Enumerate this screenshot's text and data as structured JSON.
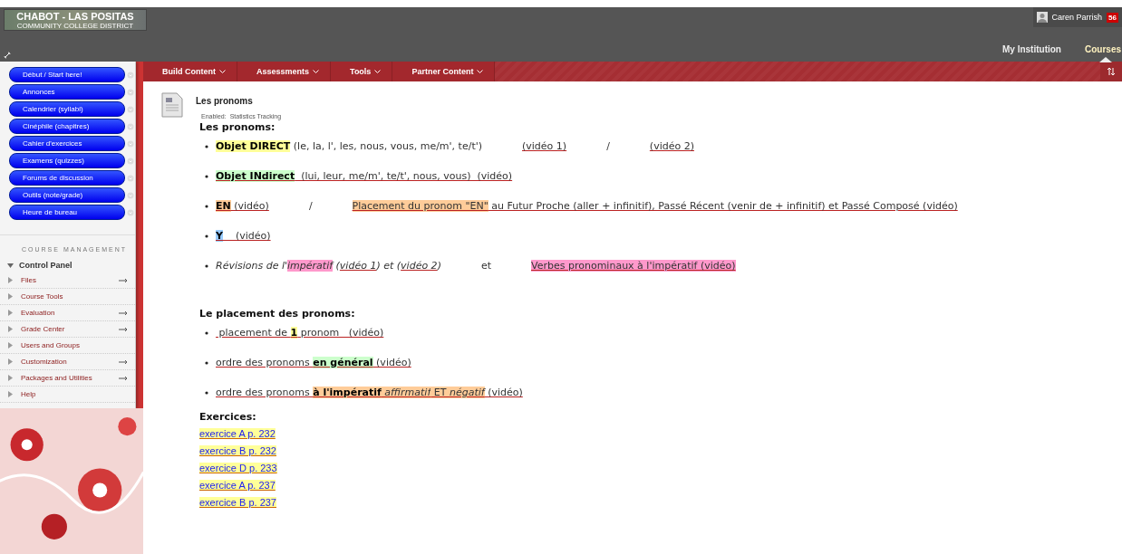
{
  "header": {
    "logo": {
      "line1": "CHABOT - LAS POSITAS",
      "line2": "COMMUNITY COLLEGE DISTRICT"
    },
    "user": {
      "name": "Caren Parrish",
      "badge": "56"
    },
    "nav": [
      {
        "label": "My Institution",
        "selected": false
      },
      {
        "label": "Courses",
        "selected": true
      }
    ]
  },
  "sidebar": {
    "course_menu": [
      "Début / Start here!",
      "Annonces",
      "Calendrier (syllabi)",
      "Cinéphile (chapitres)",
      "Cahier d'exercices",
      "Examens (quizzes)",
      "Forums de discussion",
      "Outils (note/grade)",
      "Heure de bureau"
    ],
    "management_title": "COURSE MANAGEMENT",
    "control_panel": {
      "label": "Control Panel",
      "expanded": true,
      "items": [
        {
          "label": "Files",
          "arrow": true
        },
        {
          "label": "Course Tools",
          "arrow": false
        },
        {
          "label": "Evaluation",
          "arrow": true
        },
        {
          "label": "Grade Center",
          "arrow": true
        },
        {
          "label": "Users and Groups",
          "arrow": false
        },
        {
          "label": "Customization",
          "arrow": true
        },
        {
          "label": "Packages and Utilities",
          "arrow": true
        },
        {
          "label": "Help",
          "arrow": false
        }
      ]
    }
  },
  "action_bar": [
    "Build Content",
    "Assessments",
    "Tools",
    "Partner Content"
  ],
  "content": {
    "title": "Les pronoms",
    "enabled_label": "Enabled:",
    "enabled_value": "Statistics Tracking",
    "sections": [
      {
        "heading": "Les pronoms:",
        "items": [
          [
            {
              "text": "Objet DIRECT",
              "bold": true,
              "color": "#ffff99"
            },
            {
              "text": " (le, la, l', les, nous, vous, me/m', te/t')"
            },
            {
              "text": "(vidéo 1)",
              "link": true,
              "gap": true
            },
            {
              "text": "/",
              "gap": true
            },
            {
              "text": "(vidéo 2)",
              "link": true,
              "gap": true
            }
          ],
          [
            {
              "text": "Objet INdirect",
              "bold": true,
              "link": true,
              "color": "#ccffcc"
            },
            {
              "text": "  (lui, leur, me/m', te/t', nous, vous)  (vidéo)",
              "link": true
            }
          ],
          [
            {
              "text": "EN",
              "bold": true,
              "link": true,
              "color": "#ffcc99"
            },
            {
              "text": " (vidéo)",
              "link": true
            },
            {
              "text": "/",
              "gap": true
            },
            {
              "text": "Placement du pronom \"EN\"",
              "link": true,
              "color": "#ffcc99",
              "gap": true
            },
            {
              "text": " au Futur Proche (aller + infinitif), Passé Récent (venir de + infinitif) et Passé Composé (vidéo)",
              "link": true
            }
          ],
          [
            {
              "text": "Y",
              "bold": true,
              "link": true,
              "color": "#99ccff"
            },
            {
              "text": "    (vidéo)",
              "link": true
            }
          ],
          [
            {
              "text": "Révisions de l'",
              "italic": true
            },
            {
              "text": "impératif",
              "italic": true,
              "color": "#ff99cc"
            },
            {
              "text": " (",
              "italic": true
            },
            {
              "text": "vidéo 1",
              "italic": true,
              "link": true
            },
            {
              "text": ") et (",
              "italic": true
            },
            {
              "text": "vidéo 2",
              "italic": true,
              "link": true
            },
            {
              "text": ")",
              "italic": true
            },
            {
              "text": "et",
              "gap": true
            },
            {
              "text": "Verbes pronominaux à l'impératif (vidéo)",
              "link": true,
              "color": "#ff99cc",
              "gap": true
            }
          ]
        ]
      },
      {
        "heading": "Le placement des pronoms:",
        "items": [
          [
            {
              "text": " placement de ",
              "link": true
            },
            {
              "text": "1",
              "bold": true,
              "link": true,
              "color": "#ffff99"
            },
            {
              "text": " pronom   (vidéo)",
              "link": true
            }
          ],
          [
            {
              "text": "ordre des pronoms ",
              "link": true
            },
            {
              "text": "en général",
              "bold": true,
              "link": true,
              "color": "#ccffcc"
            },
            {
              "text": " (vidéo)",
              "link": true
            }
          ],
          [
            {
              "text": "ordre des pronoms ",
              "link": true
            },
            {
              "text": "à l'impératif",
              "bold": true,
              "link": true,
              "color": "#ffcc99"
            },
            {
              "text": " affirmatif",
              "italic": true,
              "link": true,
              "color": "#ffcc99"
            },
            {
              "text": " ET ",
              "link": true,
              "color": "#ffcc99"
            },
            {
              "text": "négatif",
              "italic": true,
              "link": true,
              "color": "#ffcc99"
            },
            {
              "text": " (vidéo)",
              "link": true
            }
          ]
        ]
      }
    ],
    "exercises_heading": "Exercices:",
    "exercises": [
      "exercice A p. 232",
      "exercice B p. 232",
      "exercice D p. 233",
      "exercice A p. 237",
      "exercice B p. 237"
    ]
  }
}
